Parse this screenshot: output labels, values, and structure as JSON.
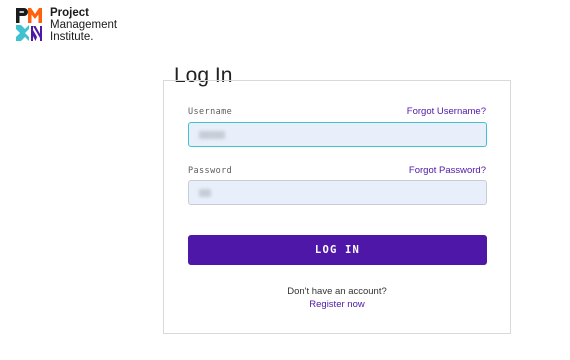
{
  "brand": {
    "line1": "Project",
    "line2": "Management",
    "line3": "Institute.",
    "colors": {
      "purple": "#4f17a8",
      "teal": "#3fc1cf",
      "orange": "#ff610f"
    },
    "icon": "pmi-logo-mark"
  },
  "page": {
    "title": "Log In"
  },
  "form": {
    "username_label": "Username",
    "forgot_username": "Forgot Username?",
    "username_value": "",
    "password_label": "Password",
    "forgot_password": "Forgot Password?",
    "password_value": "",
    "submit_label": "LOG IN",
    "no_account_text": "Don't have an account?",
    "register_label": "Register now"
  }
}
